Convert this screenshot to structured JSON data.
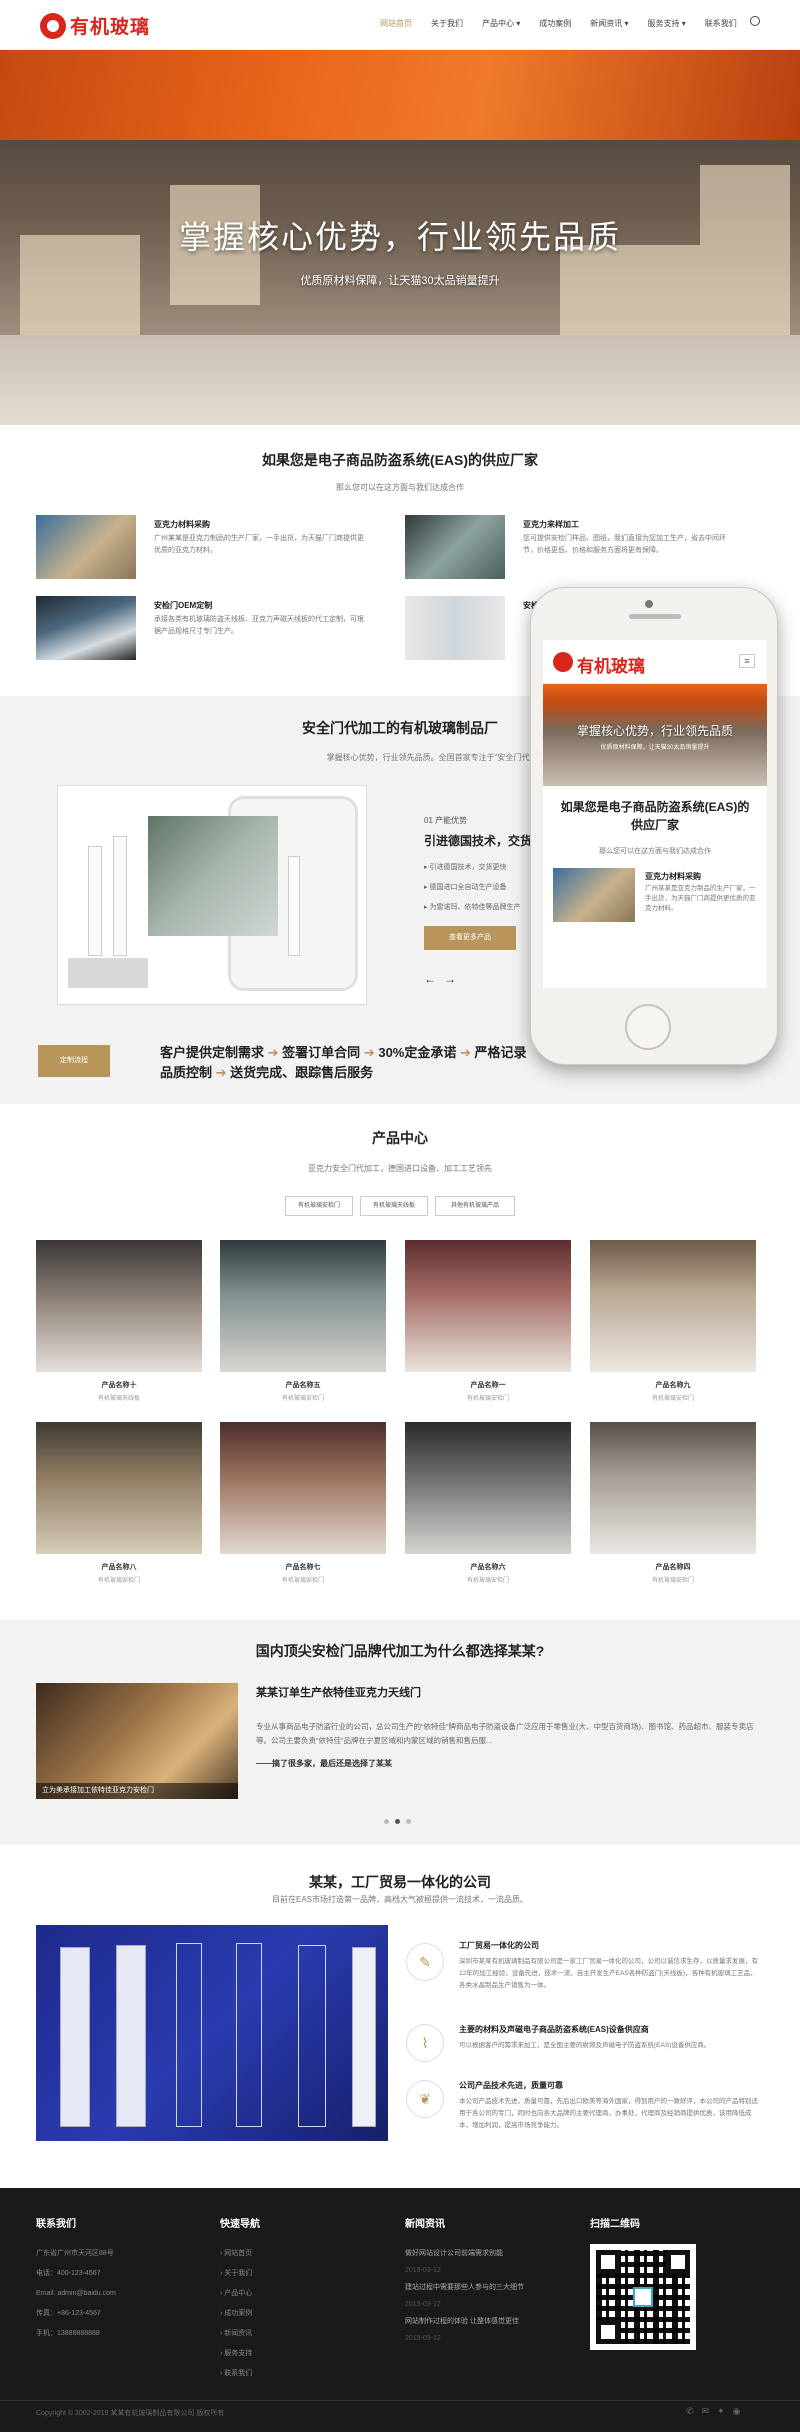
{
  "nav": {
    "logo": "有机玻璃",
    "items": [
      "网站首页",
      "关于我们",
      "产品中心",
      "成功案例",
      "新闻资讯",
      "服务支持",
      "联系我们"
    ],
    "active": 0
  },
  "hero": {
    "title": "掌握核心优势，行业领先品质",
    "subtitle": "优质原材料保障，让天猫30太品销量提升"
  },
  "features": {
    "title": "如果您是电子商品防盗系统(EAS)的供应厂家",
    "subtitle": "那么您可以在这方面与我们达成合作",
    "items": [
      {
        "title": "亚克力材料采购",
        "desc": "广州某某是亚克力制品的生产厂家，一手出货，为天猫厂门商提供更优质的亚克力材料。"
      },
      {
        "title": "亚克力来样加工",
        "desc": "您可提供安检门样品、图纸，我们直接为您加工生产，省去中间环节，价格更低、价格和服务方面将更有保障。"
      },
      {
        "title": "安检门OEM定制",
        "desc": "承接各类有机玻璃防盗天线板、亚克力声磁天线板的代工定制，可根据产品规格尺寸专门生产。"
      },
      {
        "title": "安检",
        "desc": ""
      }
    ]
  },
  "factory": {
    "title": "安全门代加工的有机玻璃制品厂",
    "subtitle": "掌握核心优势，行业领先品质。全国首家专注于“安全门代加工的有机玻璃制",
    "step": "01 产能优势",
    "heading": "引进德国技术，交货",
    "bullets": [
      "引进德国技术，交货更快",
      "德国进口全自动生产设备",
      "为雷诺玛、依特佳等品牌生产"
    ],
    "button": "查看更多产品",
    "prev": "←",
    "next": "→"
  },
  "process": {
    "button": "定制流程",
    "steps": [
      "客户提供定制需求",
      "签署订单合同",
      "30%定金承诺",
      "严格记录",
      "品质控制",
      "送货完成、跟踪售后服务"
    ]
  },
  "products": {
    "title": "产品中心",
    "subtitle": "亚克力安全门代加工，德国进口设备、加工工艺领先",
    "tabs": [
      "有机玻璃安检门",
      "有机玻璃天线板",
      "其他有机玻璃产品"
    ],
    "items": [
      {
        "name": "产品名称十",
        "cat": "有机玻璃天线板"
      },
      {
        "name": "产品名称五",
        "cat": "有机玻璃安检门"
      },
      {
        "name": "产品名称一",
        "cat": "有机玻璃安检门"
      },
      {
        "name": "产品名称九",
        "cat": "有机玻璃安检门"
      },
      {
        "name": "产品名称八",
        "cat": "有机玻璃安检门"
      },
      {
        "name": "产品名称七",
        "cat": "有机玻璃安检门"
      },
      {
        "name": "产品名称六",
        "cat": "有机玻璃安检门"
      },
      {
        "name": "产品名称四",
        "cat": "有机玻璃安检门"
      }
    ]
  },
  "why": {
    "title": "国内顶尖安检门品牌代加工为什么都选择某某?",
    "case_title": "某某订单生产依特佳亚克力天线门",
    "case_desc": "专业从事商品电子防盗行业的公司，总公司生产的“依特佳”牌商品电子防盗设备广泛应用于零售业(大、中型百货商场)、图书馆、药品超市、服装专卖店等。公司主要负责“依特佳”品牌在宁夏区域和内蒙区域的销售和售后服...",
    "case_more": "——搞了很多家，最后还是选择了某某",
    "img_caption": "立为美承接加工依特佳亚克力安检门"
  },
  "company": {
    "title": "某某，工厂贸易一体化的公司",
    "subtitle": "目前在EAS市场打造第一品牌，高档大气被極提供一流技术，一流品质。",
    "services": [
      {
        "title": "工厂贸易一体化的公司",
        "desc": "深圳市某某有机玻璃制品有限公司是一家工厂贸易一体化的公司，公司以诚信求生存，以质量求发展，有12年的加工经验，设备先进，技术一流，自主开发生产EAS各种防盗门(天线板)，各种有机玻璃工艺品，各类水晶制品生产销售为一体。",
        "icon": "pen-icon"
      },
      {
        "title": "主要的材料及声磁电子商品防盗系统(EAS)设备供应商",
        "desc": "可以根据客户的需求来加工，是全国主要的射频及声磁电子防盗系统(EAS)设备供应商。",
        "icon": "chart-icon"
      },
      {
        "title": "公司产品技术先进，质量可靠",
        "desc": "本公司产品技术先进，质量可靠，先后出口欧美等海外国家，得到用户的一致好评，本公司的产品特别适用于各公司的专门，同时也向各大品牌的主要代理商，办事处，代理商及经销商提供优质，该用降低成本，增加利润，提高市场竞争能力。",
        "icon": "handshake-icon"
      }
    ]
  },
  "footer": {
    "contact": {
      "title": "联系我们",
      "lines": [
        "广东省广州市天河区88号",
        "电话：400-123-4567",
        "Email: admin@baidu.com",
        "传真：+86-123-4567",
        "手机：13888888888"
      ]
    },
    "nav": {
      "title": "快速导航",
      "lines": [
        "网站首页",
        "关于我们",
        "产品中心",
        "成功案例",
        "新闻资讯",
        "服务支持",
        "联系我们"
      ]
    },
    "news": {
      "title": "新闻资讯",
      "lines": [
        "做好网站设计公司前端需求别能",
        "2019-03-12",
        "建站过程中需要那些人参与的三大细节",
        "2019-03-12",
        "网站制作过程的体验 让整体感觉更佳",
        "2019-03-12"
      ]
    },
    "qr": {
      "title": "扫描二维码"
    },
    "copyright": "Copyright © 2002-2019 某某有机玻璃制品有限公司 版权所有"
  },
  "phone": {
    "logo": "有机玻璃",
    "hero_title": "掌握核心优势，行业领先品质",
    "hero_sub": "优质原材料保障，让天猫30太品销量提升",
    "sec_title": "如果您是电子商品防盗系统(EAS)的供应厂家",
    "sec_sub": "那么您可以在这方面与我们达成合作",
    "item_title": "亚克力材料采购",
    "item_desc": "广州某某是亚克力制品的生产厂家，一手出货，为天猫厂门商提供更优质的亚克力材料。"
  }
}
